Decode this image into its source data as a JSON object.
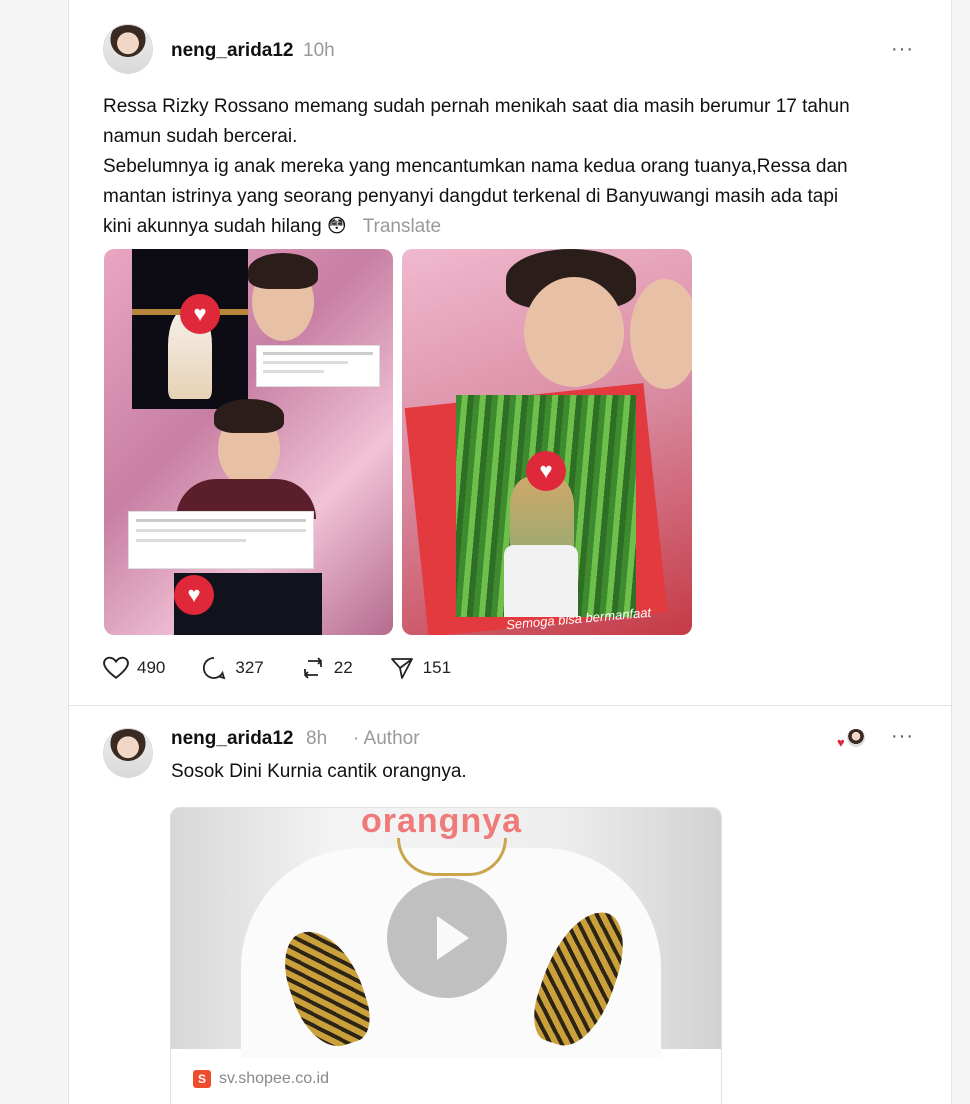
{
  "posts": [
    {
      "username": "neng_arida12",
      "time": "10h",
      "more": "···",
      "lines": [
        "Ressa Rizky Rossano memang sudah pernah menikah saat dia masih berumur 17 tahun",
        "namun sudah bercerai.",
        "Sebelumnya ig anak mereka yang mencantumkan nama kedua orang tuanya,Ressa dan",
        "mantan istrinya yang seorang penyanyi dangdut terkenal di Banyuwangi masih ada tapi",
        "kini akunnya sudah hilang 😳"
      ],
      "translate": "Translate",
      "image_caption": "Semoga bisa bermanfaat",
      "stats": {
        "likes": "490",
        "replies": "327",
        "reposts": "22",
        "shares": "151"
      }
    },
    {
      "username": "neng_arida12",
      "time": "8h",
      "author_label": "· Author",
      "more": "···",
      "text": "Sosok Dini Kurnia cantik orangnya.",
      "video_overlay_text": "orangnya",
      "link": "sv.shopee.co.id"
    }
  ],
  "colors": {
    "heart": "#e0283b",
    "muted": "#999999",
    "shopee": "#ee4d2d"
  }
}
